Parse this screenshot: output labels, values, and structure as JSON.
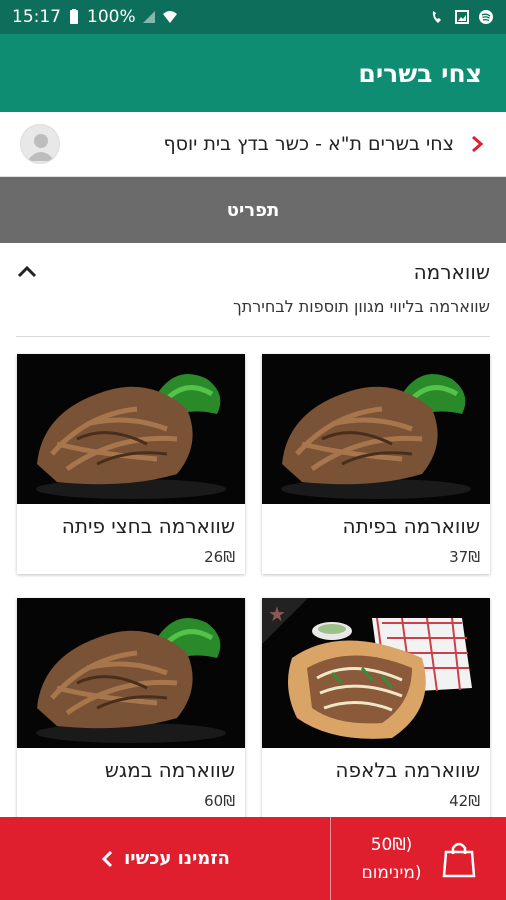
{
  "status_bar": {
    "time": "15:17",
    "battery": "100%"
  },
  "app_bar": {
    "title": "צחי בשרים"
  },
  "branch": {
    "name": "צחי בשרים ת\"א - כשר בדץ בית יוסף"
  },
  "tabs": {
    "menu_label": "תפריט"
  },
  "category": {
    "title": "שווארמה",
    "description": "שווארמה בליווי מגוון תוספות לבחירתך"
  },
  "products": [
    {
      "name": "שווארמה בפיתה",
      "price": "37₪",
      "featured": false
    },
    {
      "name": "שווארמה בחצי פיתה",
      "price": "26₪",
      "featured": false
    },
    {
      "name": "שווארמה בלאפה",
      "price": "42₪",
      "featured": true
    },
    {
      "name": "שווארמה במגש",
      "price": "60₪",
      "featured": false
    }
  ],
  "bottom_bar": {
    "order_label": "הזמינו עכשיו",
    "min_amount": "50₪)",
    "min_label": "מינימום)"
  },
  "icons": {
    "back": "chevron-right-icon",
    "collapse": "chevron-up-icon",
    "order_arrow": "chevron-left-icon",
    "cart": "shopping-bag-icon",
    "avatar": "user-avatar-icon",
    "featured": "star-icon"
  },
  "colors": {
    "status_bar": "#0d6f5b",
    "app_bar": "#0e8d72",
    "tab_bar": "#6b6b6b",
    "accent_red": "#e01f2e",
    "chevron_red": "#e01f2e"
  }
}
